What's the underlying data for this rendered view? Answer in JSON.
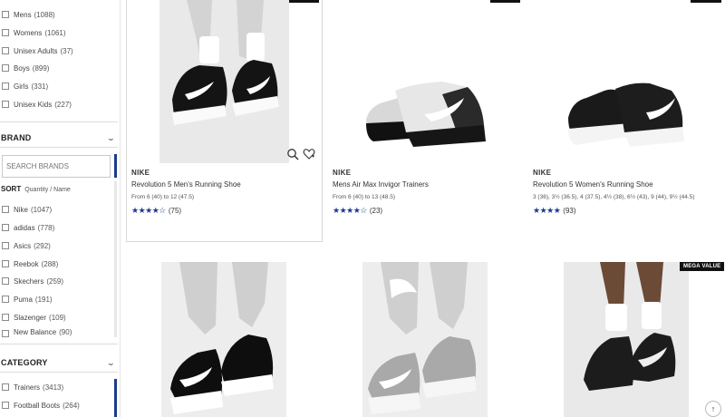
{
  "filters": {
    "gender": [
      {
        "label": "Mens",
        "count": "(1088)"
      },
      {
        "label": "Womens",
        "count": "(1061)"
      },
      {
        "label": "Unisex Adults",
        "count": "(37)"
      },
      {
        "label": "Boys",
        "count": "(899)"
      },
      {
        "label": "Girls",
        "count": "(331)"
      },
      {
        "label": "Unisex Kids",
        "count": "(227)"
      }
    ],
    "brand_title": "BRAND",
    "brand_search_placeholder": "SEARCH BRANDS",
    "sort_label": "SORT",
    "sort_options": "Quantity / Name",
    "brands": [
      {
        "label": "Nike",
        "count": "(1047)"
      },
      {
        "label": "adidas",
        "count": "(778)"
      },
      {
        "label": "Asics",
        "count": "(292)"
      },
      {
        "label": "Reebok",
        "count": "(288)"
      },
      {
        "label": "Skechers",
        "count": "(259)"
      },
      {
        "label": "Puma",
        "count": "(191)"
      },
      {
        "label": "Slazenger",
        "count": "(109)"
      },
      {
        "label": "New Balance",
        "count": "(90)"
      }
    ],
    "category_title": "CATEGORY",
    "categories": [
      {
        "label": "Trainers",
        "count": "(3413)"
      },
      {
        "label": "Football Boots",
        "count": "(264)"
      }
    ]
  },
  "products": [
    {
      "brand": "NIKE",
      "name": "Revolution 5 Men's Running Shoe",
      "sizes": "From 6 (40) to 12 (47.5)",
      "stars": "★★★★☆",
      "rating_value": 4.0,
      "reviews": "(75)"
    },
    {
      "brand": "NIKE",
      "name": "Mens Air Max Invigor Trainers",
      "sizes": "From 6 (40) to 13 (48.5)",
      "stars": "★★★★☆",
      "rating_value": 4.5,
      "reviews": "(23)"
    },
    {
      "brand": "NIKE",
      "name": "Revolution 5 Women's Running Shoe",
      "sizes": "3 (36), 3½ (36.5), 4 (37.5), 4½ (38), 6½ (43), 9 (44), 9½ (44.5)",
      "stars": "★★★★",
      "rating_value": 4.0,
      "reviews": "(93)"
    }
  ],
  "badge_label": "MEGA VALUE",
  "top_label": "↑",
  "colors": {
    "accent": "#1b3b8f",
    "badge": "#111111",
    "image_bg": "#eaeaea"
  },
  "icons": {
    "search": "search-icon",
    "wishlist": "heart-plus-icon",
    "chevron": "chevron-down-icon",
    "back_to_top": "arrow-up-icon"
  }
}
